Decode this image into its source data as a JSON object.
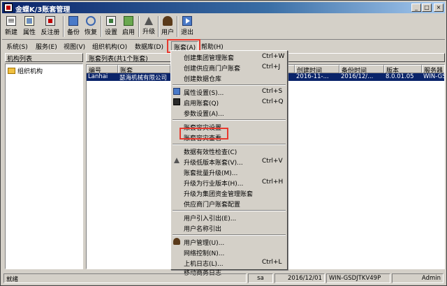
{
  "window": {
    "title": "金蝶K/3账套管理"
  },
  "toolbar": {
    "buttons": [
      {
        "label": "新建",
        "icon": "new-document-icon"
      },
      {
        "label": "属性",
        "icon": "properties-icon"
      },
      {
        "label": "反注册",
        "icon": "unregister-icon"
      },
      {
        "label": "备份",
        "icon": "backup-icon"
      },
      {
        "label": "恢复",
        "icon": "restore-icon"
      },
      {
        "label": "设置",
        "icon": "settings-icon"
      },
      {
        "label": "启用",
        "icon": "enable-icon"
      },
      {
        "label": "升级",
        "icon": "upgrade-arrow-icon"
      },
      {
        "label": "用户",
        "icon": "user-icon"
      },
      {
        "label": "退出",
        "icon": "exit-icon"
      }
    ]
  },
  "menubar": {
    "items": [
      "系统(S)",
      "服务(E)",
      "视图(V)",
      "组织机构(O)",
      "数据库(D)",
      "账套(A)",
      "帮助(H)"
    ],
    "active": "账套(A)"
  },
  "left_panel": {
    "header": "机构列表",
    "tree": [
      "组织机构"
    ]
  },
  "right_panel": {
    "header": "账套列表(共1个账套)",
    "columns": [
      "编号",
      "账套",
      "",
      "",
      "创建时间",
      "备份时间",
      "版本",
      "服务器"
    ],
    "rows": [
      [
        "Lanhai",
        "瑟海机械有限公司",
        "",
        "",
        "2016-11-...",
        "2016/12/...",
        "8.0.01.05",
        "WIN-GS..."
      ]
    ]
  },
  "dropdown": {
    "items": [
      {
        "label": "创建集团管理账套",
        "shortcut": "Ctrl+W",
        "icon": ""
      },
      {
        "label": "创建供应商门户账套",
        "shortcut": "Ctrl+J",
        "icon": ""
      },
      {
        "label": "创建数据仓库",
        "shortcut": "",
        "icon": ""
      },
      {
        "sep": true
      },
      {
        "label": "属性设置(S)...",
        "shortcut": "Ctrl+S",
        "icon": "properties-icon"
      },
      {
        "label": "启用账套(Q)",
        "shortcut": "Ctrl+Q",
        "icon": "enable-icon"
      },
      {
        "label": "参数设置(A)...",
        "shortcut": "",
        "icon": ""
      },
      {
        "sep": true
      },
      {
        "label": "账套容灾设置",
        "shortcut": "",
        "icon": ""
      },
      {
        "label": "账套容灾查看",
        "shortcut": "",
        "icon": ""
      },
      {
        "sep": true
      },
      {
        "label": "数据有效性检查(C)",
        "shortcut": "",
        "icon": ""
      },
      {
        "label": "升级低版本账套(V)...",
        "shortcut": "Ctrl+V",
        "icon": "upgrade-arrow-icon"
      },
      {
        "label": "账套批量升级(M)...",
        "shortcut": "",
        "icon": ""
      },
      {
        "label": "升级为行业版本(H)...",
        "shortcut": "Ctrl+H",
        "icon": ""
      },
      {
        "label": "升级为集团资金管理账套",
        "shortcut": "",
        "icon": ""
      },
      {
        "label": "供应商门户账套配置",
        "shortcut": "",
        "icon": ""
      },
      {
        "sep": true
      },
      {
        "label": "用户引入引出(E)...",
        "shortcut": "",
        "icon": ""
      },
      {
        "label": "用户名称引出",
        "shortcut": "",
        "icon": ""
      },
      {
        "sep": true
      },
      {
        "label": "用户管理(U)...",
        "shortcut": "",
        "icon": "user-icon"
      },
      {
        "label": "网络控制(N)...",
        "shortcut": "",
        "icon": ""
      },
      {
        "label": "上机日志(L)...",
        "shortcut": "Ctrl+L",
        "icon": ""
      },
      {
        "label": "移动商务日志",
        "shortcut": "",
        "icon": ""
      }
    ]
  },
  "statusbar": {
    "status": "就绪",
    "user": "sa",
    "date": "2016/12/01",
    "server": "WIN-GSDJTKV49P",
    "role": "Admin"
  },
  "highlight": {
    "color": "#e8392e"
  }
}
